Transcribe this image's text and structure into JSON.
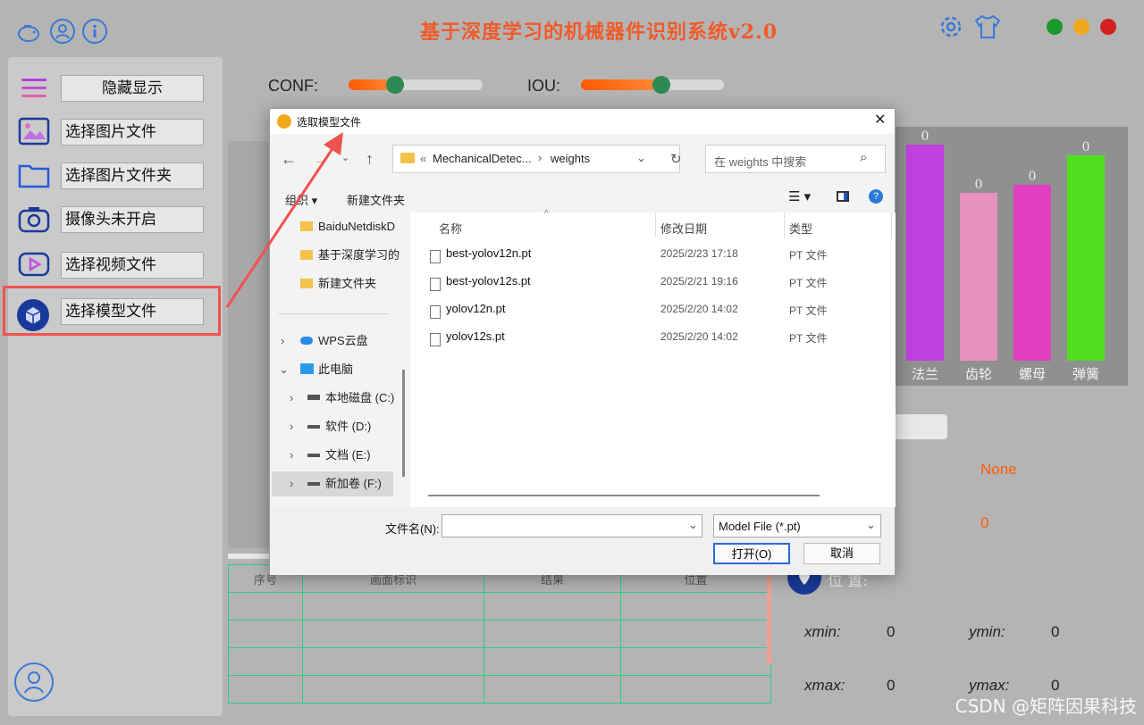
{
  "app": {
    "title": "基于深度学习的机械器件识别系统v2.0",
    "watermark": "CSDN @矩阵因果科技"
  },
  "topbar": {
    "left_icons": [
      "piggy-bank-icon",
      "user-icon",
      "info-icon"
    ],
    "right_icons": [
      "gear-icon",
      "tshirt-icon"
    ],
    "window_dots": [
      "#1a9a2a",
      "#f2a81c",
      "#d42020"
    ]
  },
  "sidebar": {
    "toggle_label": "隐藏显示",
    "items": [
      {
        "label": "选择图片文件",
        "icon": "image-icon"
      },
      {
        "label": "选择图片文件夹",
        "icon": "folder-icon"
      },
      {
        "label": "摄像头未开启",
        "icon": "camera-icon"
      },
      {
        "label": "选择视频文件",
        "icon": "video-icon"
      },
      {
        "label": "选择模型文件",
        "icon": "model-icon"
      }
    ]
  },
  "sliders": {
    "conf_label": "CONF:",
    "conf_value": 0.28,
    "iou_label": "IOU:",
    "iou_value": 0.5
  },
  "chart_data": {
    "type": "bar",
    "categories": [
      "法兰",
      "齿轮",
      "螺母",
      "弹簧"
    ],
    "values": [
      0,
      0,
      0,
      0
    ],
    "bar_heights_display": [
      242,
      188,
      197,
      230
    ],
    "colors": [
      "#c040e0",
      "#e890c0",
      "#e040c0",
      "#50e020"
    ]
  },
  "result": {
    "class_value": "None",
    "conf_value": "0",
    "location_label": "位 置:",
    "xmin_label": "xmin:",
    "xmin": "0",
    "ymin_label": "ymin:",
    "ymin": "0",
    "xmax_label": "xmax:",
    "xmax": "0",
    "ymax_label": "ymax:",
    "ymax": "0"
  },
  "table": {
    "headers": [
      "序号",
      "画面标识",
      "结果",
      "位置"
    ]
  },
  "dialog": {
    "title": "选取模型文件",
    "breadcrumb_prefix": "«",
    "breadcrumb_parent": "MechanicalDetec...",
    "breadcrumb_current": "weights",
    "search_placeholder": "在 weights 中搜索",
    "organize": "组织 ▾",
    "new_folder": "新建文件夹",
    "tree": [
      {
        "label": "BaiduNetdiskD",
        "icon": "folder-icon"
      },
      {
        "label": "基于深度学习的",
        "icon": "folder-icon"
      },
      {
        "label": "新建文件夹",
        "icon": "folder-icon"
      },
      {
        "label": "WPS云盘",
        "icon": "cloud-icon"
      },
      {
        "label": "此电脑",
        "icon": "pc-icon"
      },
      {
        "label": "本地磁盘 (C:)",
        "icon": "drive-icon"
      },
      {
        "label": "软件 (D:)",
        "icon": "drive-icon"
      },
      {
        "label": "文档 (E:)",
        "icon": "drive-icon"
      },
      {
        "label": "新加卷 (F:)",
        "icon": "drive-icon"
      }
    ],
    "columns": [
      "名称",
      "修改日期",
      "类型"
    ],
    "files": [
      {
        "name": "best-yolov12n.pt",
        "date": "2025/2/23 17:18",
        "type": "PT 文件"
      },
      {
        "name": "best-yolov12s.pt",
        "date": "2025/2/21 19:16",
        "type": "PT 文件"
      },
      {
        "name": "yolov12n.pt",
        "date": "2025/2/20 14:02",
        "type": "PT 文件"
      },
      {
        "name": "yolov12s.pt",
        "date": "2025/2/20 14:02",
        "type": "PT 文件"
      }
    ],
    "filename_label": "文件名(N):",
    "filename_value": "",
    "filter": "Model File (*.pt)",
    "open": "打开(O)",
    "cancel": "取消"
  }
}
